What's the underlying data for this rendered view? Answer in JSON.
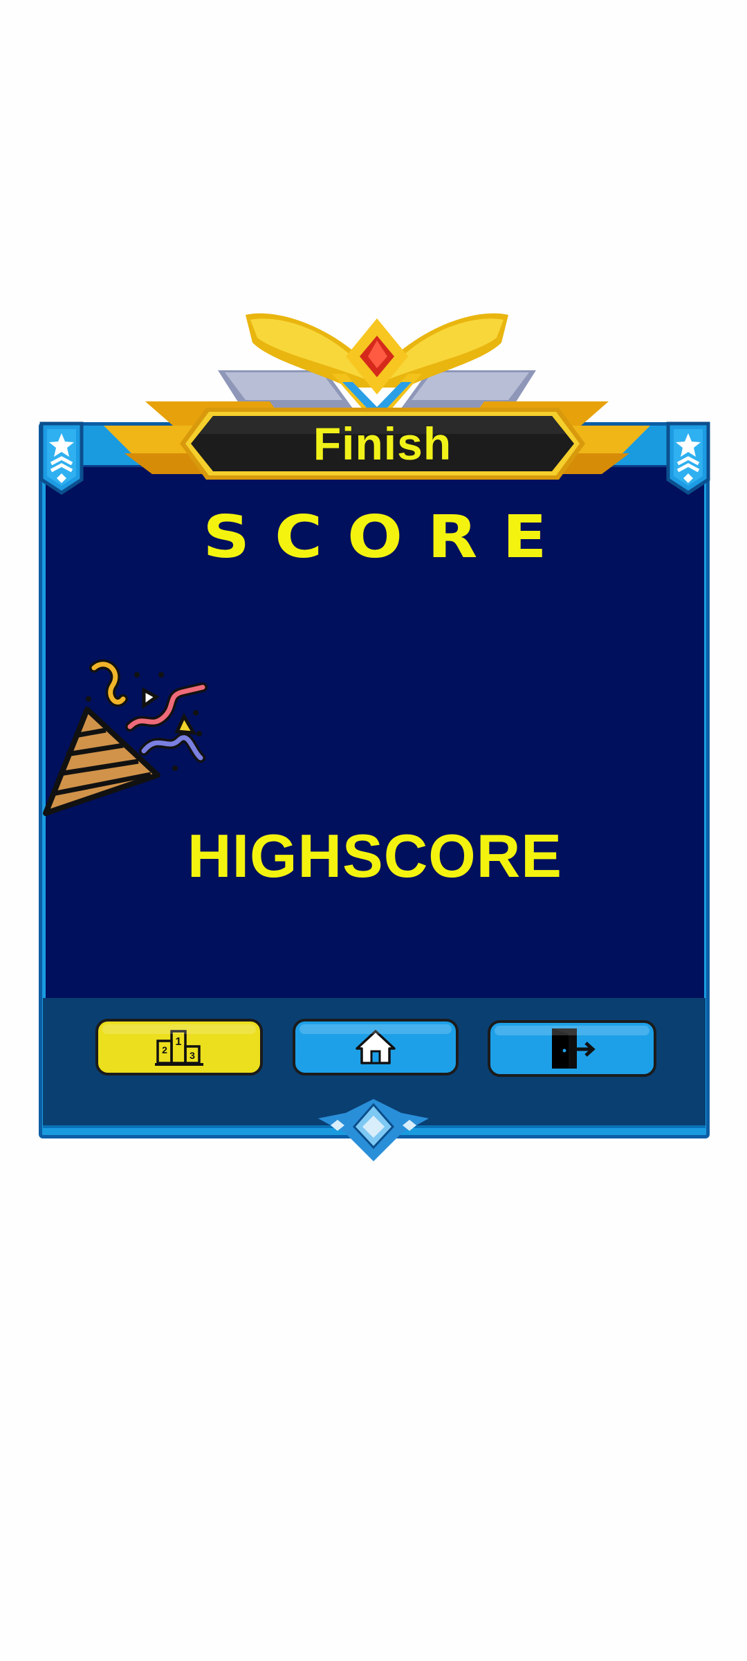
{
  "banner": {
    "title": "Finish"
  },
  "main": {
    "score_label": "SCORE",
    "highscore_label": "HIGHSCORE"
  },
  "buttons": [
    {
      "id": "leaderboard",
      "icon": "podium-icon"
    },
    {
      "id": "home",
      "icon": "home-icon"
    },
    {
      "id": "exit",
      "icon": "exit-door-icon"
    }
  ],
  "colors": {
    "panel_border": "#1a9be0",
    "panel_bg": "#01105c",
    "footer_bg": "#0a3f72",
    "text_yellow": "#f3f30f",
    "button_yellow": "#ecdf1e",
    "button_blue": "#1ea0e8",
    "gold": "#f2c21a"
  }
}
